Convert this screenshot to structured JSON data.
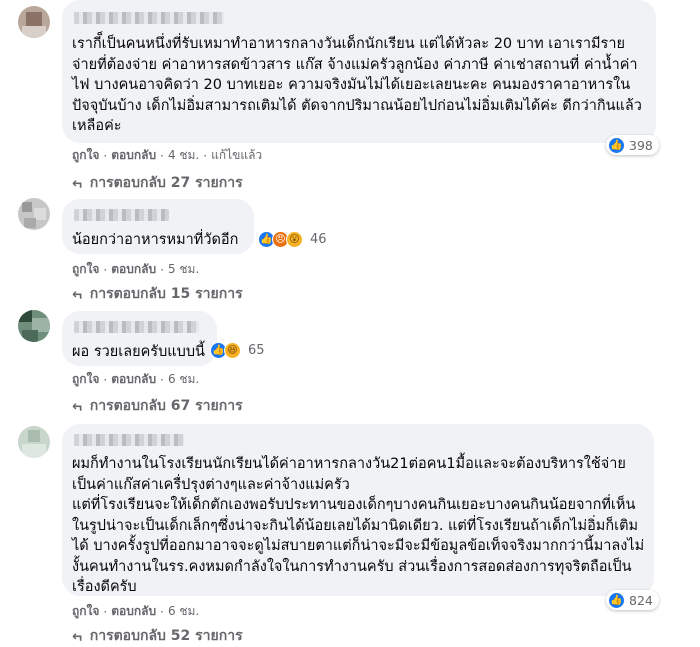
{
  "comments": [
    {
      "text": "เรากี็เป็นคนหนึ่งที่รับเหมาทำอาหารกลางวันเด็กนักเรียน แต่ได้หัวละ 20 บาท เอาเรามีรายจ่ายที่ต้องจ่าย ค่าอาหารสดข้าวสาร แก๊ส จ้างแม่ครัวลูกน้อง ค่าภาษี ค่าเช่าสถานที่ ค่าน้ำค่าไฟ บางคนอาจคิดว่า 20 บาทเยอะ ความจริงมันไม่ได้เยอะเลยนะคะ คนมองราคาอาหารในปัจจุบันบ้าง เด็กไม่อิ่มสามารถเติมได้ ตัดจากปริมาณน้อยไปก่อนไม่อิ่มเติมได้ค่ะ ดีกว่ากินแล้วเหลือค่ะ",
      "like_label": "ถูกใจ",
      "reply_label": "ตอบกลับ",
      "time": "4 ชม.",
      "edited": "แก้ไขแล้ว",
      "reaction_count": "398",
      "replies_label": "การตอบกลับ 27 รายการ"
    },
    {
      "text": "น้อยกว่าอาหารหมาที่วัดอีก",
      "like_label": "ถูกใจ",
      "reply_label": "ตอบกลับ",
      "time": "5 ชม.",
      "reaction_count": "46",
      "replies_label": "การตอบกลับ 15 รายการ"
    },
    {
      "text": "ผอ รวยเลยครับแบบนี้",
      "like_label": "ถูกใจ",
      "reply_label": "ตอบกลับ",
      "time": "6 ชม.",
      "reaction_count": "65",
      "replies_label": "การตอบกลับ 67 รายการ"
    },
    {
      "text": "ผมก็ทำงานในโรงเรียนนักเรียนได้ค่าอาหารกลางวัน21ต่อคน1มื้อและจะต้องบริหารใช้จ่ายเป็นค่าแก๊สค่าเครื่ปรุงต่างๆและค่าจ้างแม่ครัว\nแต่ที่โรงเรียนจะให้เด็กตักเองพอรับประทานของเด็กๆบางคนกินเยอะบางคนกินน้อยจากที่เห็นในรูปน่าจะเป็นเด็กเล็กๆซึ่งน่าจะกินได้น้อยเลยได้มานิดเดียว. แต่ที่โรงเรียนถ้าเด็กไม่อิ่มก็เติมได้ บางครั้งรูปที่ออกมาอาจจะดูไม่สบายตาแต่ก็น่าจะมีจะมีข้อมูลข้อเท็จจริงมากกว่านี้มาลงไม่งั้นคนทำงานในรร.คงหมดกำลังใจในการทำงานครับ ส่วนเรื่องการสอดส่องการทุจริตถือเป็นเรื่องดีครับ",
      "like_label": "ถูกใจ",
      "reply_label": "ตอบกลับ",
      "time": "6 ชม.",
      "reaction_count": "824",
      "replies_label": "การตอบกลับ 52 รายการ"
    }
  ],
  "colors": {
    "like": "#1877f2",
    "bubble": "#f0f2f5",
    "meta": "#65676b"
  },
  "icons": [
    "like-icon",
    "haha-icon",
    "angry-icon",
    "wow-icon",
    "reply-arrow-icon"
  ]
}
